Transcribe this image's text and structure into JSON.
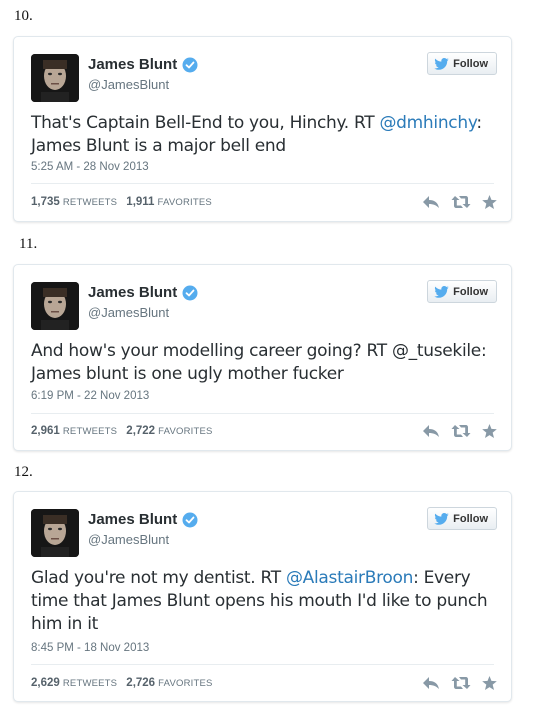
{
  "tweets": [
    {
      "number": "10.",
      "name": "James Blunt",
      "handle": "@JamesBlunt",
      "follow_label": "Follow",
      "text_before": "That's Captain Bell-End to you, Hinchy.  RT ",
      "mention": "@dmhinchy",
      "text_after": ": James Blunt is a major bell end",
      "timestamp": "5:25 AM - 28 Nov 2013",
      "retweets": "1,735",
      "retweets_label": "RETWEETS",
      "favorites": "1,911",
      "favorites_label": "FAVORITES"
    },
    {
      "number": "11.",
      "name": "James Blunt",
      "handle": "@JamesBlunt",
      "follow_label": "Follow",
      "text_before": "And how's your modelling career going? RT @_tusekile: James blunt is one ugly mother fucker",
      "mention": "",
      "text_after": "",
      "timestamp": "6:19 PM - 22 Nov 2013",
      "retweets": "2,961",
      "retweets_label": "RETWEETS",
      "favorites": "2,722",
      "favorites_label": "FAVORITES"
    },
    {
      "number": "12.",
      "name": "James Blunt",
      "handle": "@JamesBlunt",
      "follow_label": "Follow",
      "text_before": "Glad you're not my dentist. RT ",
      "mention": "@AlastairBroon",
      "text_after": ": Every time that James Blunt opens his mouth I'd like to punch him in it",
      "timestamp": "8:45 PM - 18 Nov 2013",
      "retweets": "2,629",
      "retweets_label": "RETWEETS",
      "favorites": "2,726",
      "favorites_label": "FAVORITES"
    }
  ],
  "icons": {
    "verified": "verified-badge-icon",
    "follow": "twitter-bird-icon",
    "reply": "reply-icon",
    "retweet": "retweet-icon",
    "favorite": "star-icon"
  },
  "colors": {
    "link": "#2b7bb9",
    "verified": "#55acee",
    "action_icon": "#8899a6"
  }
}
